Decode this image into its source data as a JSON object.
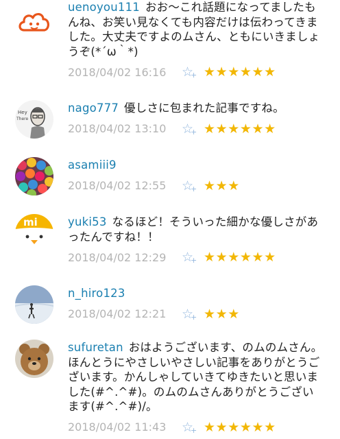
{
  "comments": [
    {
      "username": "uenoyou111",
      "text": "おお〜これ話題になってましたもんね、お笑い見なくても内容だけは伝わってきました。大丈夫ですよのムさん、ともにいきましょうぞ(*´ω｀*)",
      "date": "2018/04/02 16:16",
      "stars": "★★★★★★",
      "rating": 6,
      "avatar_icon": "cloud-face-avatar"
    },
    {
      "username": "nago777",
      "text": "優しさに包まれた記事ですね。",
      "date": "2018/04/02 13:10",
      "stars": "★★★★★★",
      "rating": 6,
      "avatar_icon": "sketch-portrait-avatar"
    },
    {
      "username": "asamiii9",
      "text": "",
      "date": "2018/04/02 12:55",
      "stars": "★★★",
      "rating": 3,
      "avatar_icon": "colorful-pompoms-avatar"
    },
    {
      "username": "yuki53",
      "text": "なるほど！そういった細かな優しさがあったんですね！！",
      "date": "2018/04/02 12:29",
      "stars": "★★★★★★",
      "rating": 6,
      "avatar_icon": "mi-chick-avatar"
    },
    {
      "username": "n_hiro123",
      "text": "",
      "date": "2018/04/02 12:21",
      "stars": "★★★",
      "rating": 3,
      "avatar_icon": "snowy-landscape-avatar"
    },
    {
      "username": "sufuretan",
      "text": "おはようございます、のムのムさん。ほんとうにやさしいやさしい記事をありがとうございます。かんしゃしていきてゆきたいと思いました(#^.^#)。のムのムさんありがとうございます(#^.^#)/。",
      "date": "2018/04/02 11:43",
      "stars": "★★★★★★",
      "rating": 6,
      "avatar_icon": "teddy-bear-avatar"
    }
  ],
  "icons": {
    "favorite": "star-plus-icon",
    "rating": "star-icon"
  },
  "colors": {
    "username": "#1a7fb0",
    "date": "#b4b4b4",
    "stars": "#f2b705",
    "favorite": "#93b7de"
  }
}
